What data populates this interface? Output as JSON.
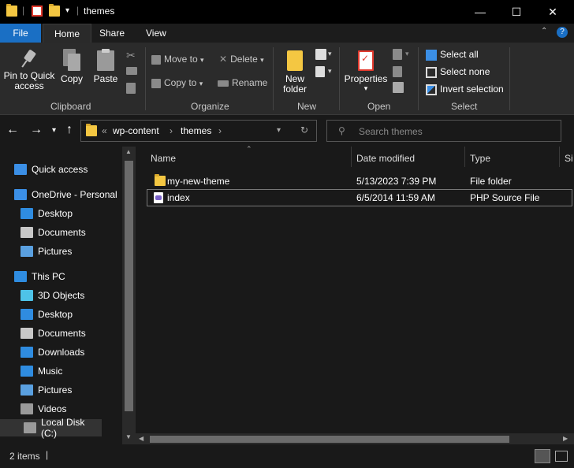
{
  "window": {
    "title": "themes",
    "controls": {
      "minimize": "—",
      "maximize": "☐",
      "close": "✕"
    }
  },
  "ribbon": {
    "tabs": [
      "File",
      "Home",
      "Share",
      "View"
    ],
    "help": "?",
    "clipboard": {
      "pin_label_1": "Pin to Quick",
      "pin_label_2": "access",
      "copy": "Copy",
      "paste": "Paste",
      "group": "Clipboard"
    },
    "organize": {
      "move_to": "Move to",
      "copy_to": "Copy to",
      "delete": "Delete",
      "rename": "Rename",
      "group": "Organize"
    },
    "new": {
      "new_folder_1": "New",
      "new_folder_2": "folder",
      "group": "New"
    },
    "open": {
      "properties": "Properties",
      "group": "Open"
    },
    "select": {
      "select_all": "Select all",
      "select_none": "Select none",
      "invert": "Invert selection",
      "group": "Select"
    }
  },
  "address": {
    "overflow": "«",
    "crumbs": [
      "wp-content",
      "themes"
    ],
    "search_placeholder": "Search themes"
  },
  "sidebar": {
    "items": [
      {
        "label": "Quick access",
        "icon": "star-icon",
        "color": "#3b8fe6"
      },
      {
        "label": "OneDrive - Personal",
        "icon": "cloud-icon",
        "color": "#3b8fe6"
      },
      {
        "label": "Desktop",
        "icon": "desktop-icon",
        "color": "#2f8ce0"
      },
      {
        "label": "Documents",
        "icon": "documents-icon",
        "color": "#c8c8c8"
      },
      {
        "label": "Pictures",
        "icon": "pictures-icon",
        "color": "#5aa0e0"
      },
      {
        "label": "This PC",
        "icon": "pc-icon",
        "color": "#2f8ce0"
      },
      {
        "label": "3D Objects",
        "icon": "cube-icon",
        "color": "#4ec3e8"
      },
      {
        "label": "Desktop",
        "icon": "desktop-icon",
        "color": "#2f8ce0"
      },
      {
        "label": "Documents",
        "icon": "documents-icon",
        "color": "#c8c8c8"
      },
      {
        "label": "Downloads",
        "icon": "download-icon",
        "color": "#2f8ce0"
      },
      {
        "label": "Music",
        "icon": "music-icon",
        "color": "#2f8ce0"
      },
      {
        "label": "Pictures",
        "icon": "pictures-icon",
        "color": "#5aa0e0"
      },
      {
        "label": "Videos",
        "icon": "videos-icon",
        "color": "#9a9a9a"
      },
      {
        "label": "Local Disk (C:)",
        "icon": "disk-icon",
        "color": "#9a9a9a"
      }
    ]
  },
  "table": {
    "columns": [
      "Name",
      "Date modified",
      "Type",
      "Si"
    ],
    "rows": [
      {
        "name": "my-new-theme",
        "date": "5/13/2023 7:39 PM",
        "type": "File folder",
        "icon": "folder-icon"
      },
      {
        "name": "index",
        "date": "6/5/2014 11:59 AM",
        "type": "PHP Source File",
        "icon": "php-file-icon"
      }
    ]
  },
  "status": {
    "count": "2 items"
  },
  "colors": {
    "accent": "#1a6fc4",
    "folder": "#f4c742",
    "bg": "#191919"
  }
}
